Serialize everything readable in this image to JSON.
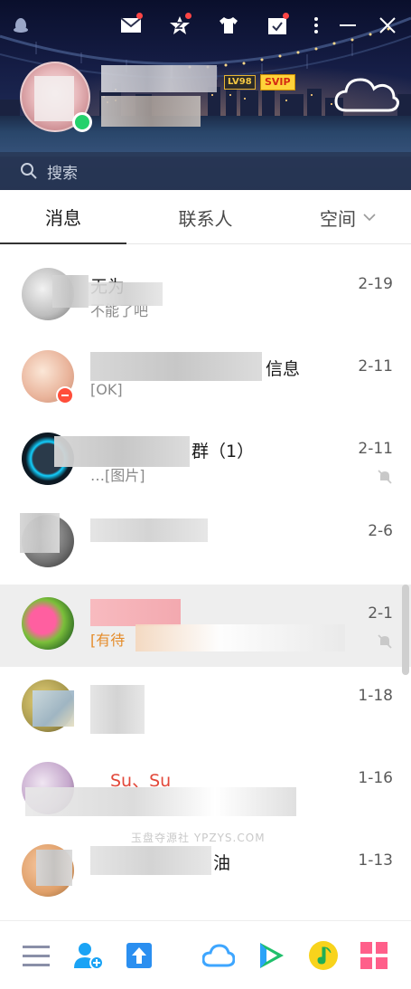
{
  "header": {
    "search_placeholder": "搜索",
    "level_badge": "LV98",
    "vip_badge": "SVIP",
    "icons": [
      "qq-penguin-icon",
      "mail-icon",
      "qzone-star-icon",
      "tshirt-icon",
      "calendar-check-icon",
      "more-icon",
      "minimize-icon",
      "close-icon"
    ]
  },
  "tabs": [
    {
      "label": "消息"
    },
    {
      "label": "联系人"
    },
    {
      "label": "空间"
    }
  ],
  "conversations": [
    {
      "title": "无为",
      "subtitle": "不能了吧",
      "date": "2-19"
    },
    {
      "title": "信息",
      "subtitle": "[OK]",
      "date": "2-11"
    },
    {
      "title": "群（1）",
      "subtitle": "…[图片]",
      "date": "2-11"
    },
    {
      "title": "",
      "subtitle": "",
      "date": "2-6"
    },
    {
      "title": "",
      "subtitle": "[有待",
      "date": "2-1"
    },
    {
      "title": "",
      "subtitle": "",
      "date": "1-18"
    },
    {
      "title": "Su、Su",
      "subtitle": "",
      "date": "1-16"
    },
    {
      "title": "油",
      "subtitle": "",
      "date": "1-13"
    }
  ],
  "watermark": "玉盘夺源社 YPZYS.COM",
  "bottom_icons": [
    "menu-icon",
    "add-contact-icon",
    "upload-icon",
    "cloud-icon",
    "video-play-icon",
    "music-icon",
    "apps-grid-icon"
  ],
  "colors": {
    "accent_red": "#ff4545",
    "online_green": "#24d16b",
    "svip_gold": "#ffd23a"
  }
}
